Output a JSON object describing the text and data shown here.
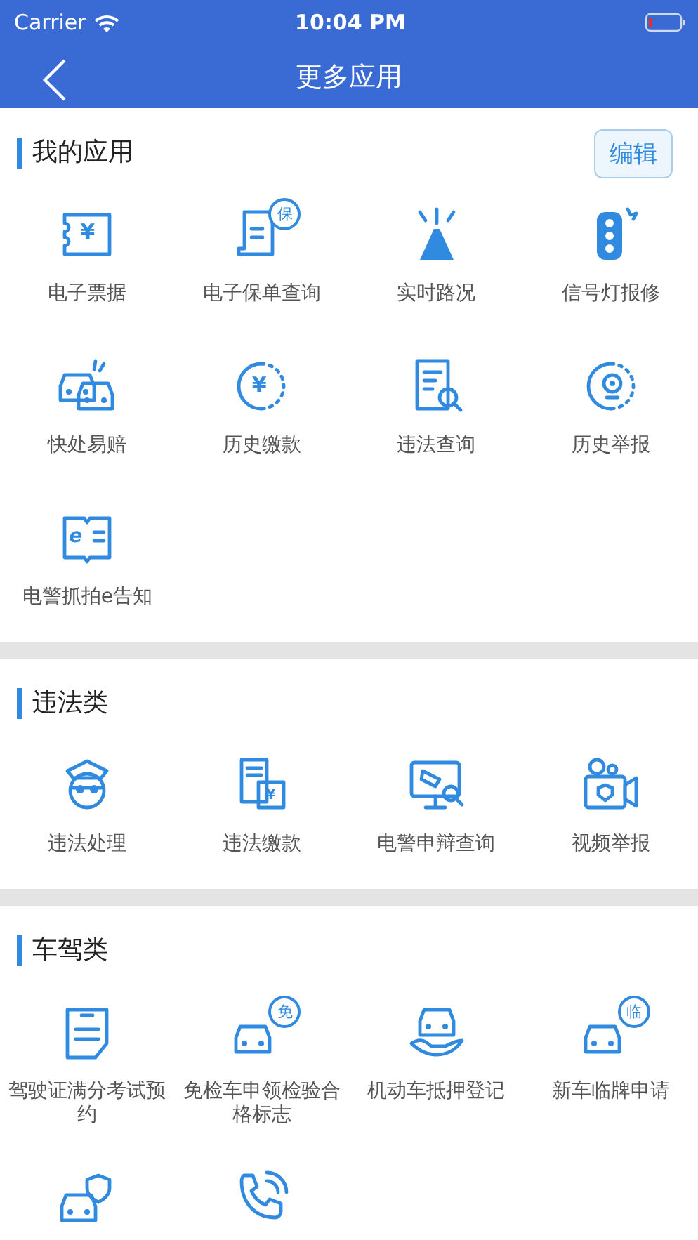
{
  "status_bar": {
    "carrier": "Carrier",
    "time": "10:04 PM"
  },
  "nav": {
    "title": "更多应用"
  },
  "sections": [
    {
      "title": "我的应用",
      "action": "编辑",
      "items": [
        {
          "label": "电子票据",
          "glyph": "¥"
        },
        {
          "label": "电子保单查询",
          "badge": "保"
        },
        {
          "label": "实时路况"
        },
        {
          "label": "信号灯报修"
        },
        {
          "label": "快处易赔"
        },
        {
          "label": "历史缴款",
          "glyph": "¥"
        },
        {
          "label": "违法查询"
        },
        {
          "label": "历史举报"
        },
        {
          "label": "电警抓拍e告知",
          "glyph": "e"
        }
      ]
    },
    {
      "title": "违法类",
      "items": [
        {
          "label": "违法处理"
        },
        {
          "label": "违法缴款",
          "glyph": "¥"
        },
        {
          "label": "电警申辩查询"
        },
        {
          "label": "视频举报"
        }
      ]
    },
    {
      "title": "车驾类",
      "items": [
        {
          "label": "驾驶证满分考试预约"
        },
        {
          "label": "免检车申领检验合格标志",
          "badge": "免"
        },
        {
          "label": "机动车抵押登记"
        },
        {
          "label": "新车临牌申请",
          "badge": "临"
        },
        {
          "kind": "icon-only"
        },
        {
          "kind": "icon-only"
        }
      ]
    }
  ]
}
